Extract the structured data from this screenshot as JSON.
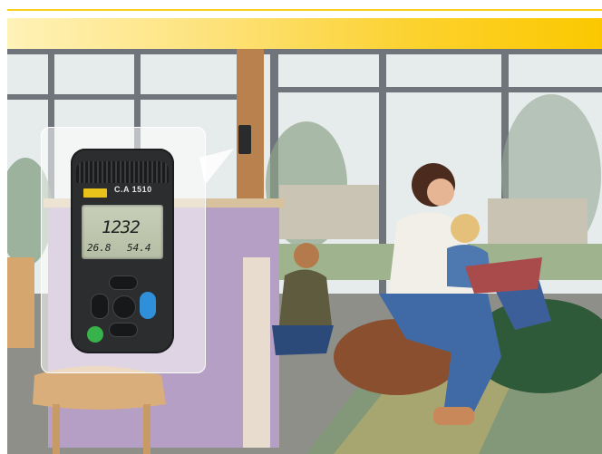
{
  "banner": {
    "color_primary": "#fbc800",
    "color_light": "#fff2b8"
  },
  "device": {
    "model": "C.A 1510",
    "reading_main": "1232",
    "reading_temperature": "26.8",
    "reading_humidity": "54.4",
    "colors": {
      "body": "#2b2d2f",
      "display": "#c2c9b0",
      "button_blue": "#2f8fd8",
      "button_green": "#38b24a"
    }
  }
}
